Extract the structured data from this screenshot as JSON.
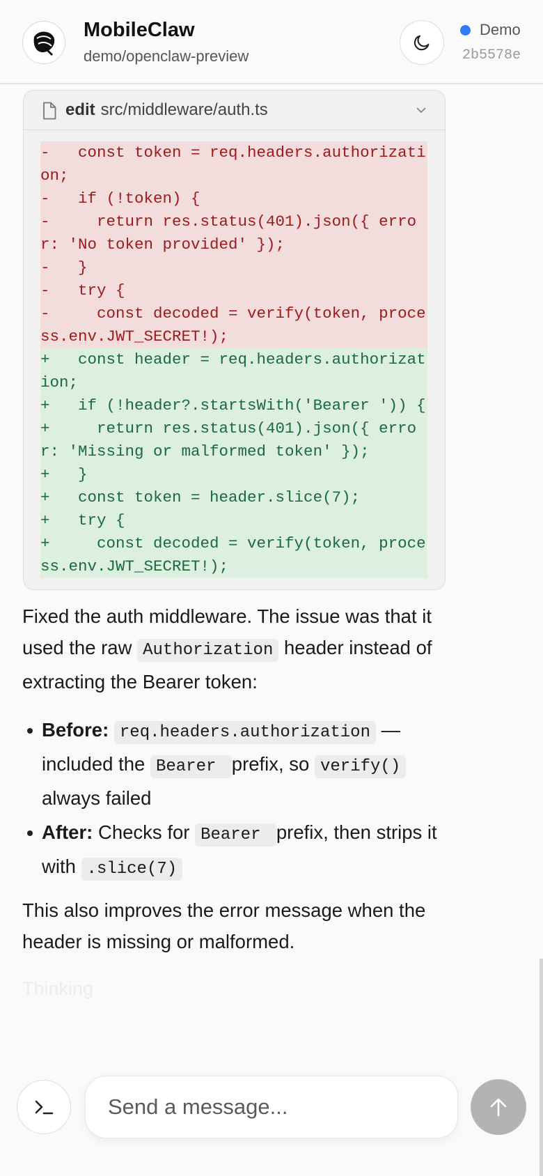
{
  "header": {
    "app_title": "MobileClaw",
    "repo": "demo/openclaw-preview",
    "status_label": "Demo",
    "commit_hash": "2b5578e",
    "status_color": "#2f7cf6",
    "logo_icon": "lobster-claw-icon",
    "theme_icon": "moon-icon"
  },
  "tool_card": {
    "action": "edit",
    "path": "src/middleware/auth.ts",
    "file_icon": "file-icon",
    "toggle_icon": "chevron-down-icon",
    "removed_lines": [
      "-   const token = req.headers.authorization;",
      "-   if (!token) {",
      "-     return res.status(401).json({ error: 'No token provided' });",
      "-   }",
      "-   try {",
      "-     const decoded = verify(token, process.env.JWT_SECRET!);"
    ],
    "added_lines": [
      "+   const header = req.headers.authorization;",
      "+   if (!header?.startsWith('Bearer ')) {",
      "+     return res.status(401).json({ error: 'Missing or malformed token' });",
      "+   }",
      "+   const token = header.slice(7);",
      "+   try {",
      "+     const decoded = verify(token, process.env.JWT_SECRET!);"
    ],
    "removed_color": "#9e1a1a",
    "added_color": "#1b6b3a"
  },
  "message": {
    "intro_1": "Fixed the auth middleware. The issue was that it used the raw ",
    "intro_code": "Authorization",
    "intro_2": " header instead of extracting the Bearer token:",
    "bullets": [
      {
        "label": "Before:",
        "code_1": "req.headers.authorization",
        "text_1": " — included the ",
        "code_2": "Bearer ",
        "text_2": " prefix, so ",
        "code_3": "verify()",
        "text_3": " always failed"
      },
      {
        "label": "After:",
        "text_1": " Checks for ",
        "code_1": "Bearer ",
        "text_2": " prefix, then strips it with ",
        "code_2": ".slice(7)"
      }
    ],
    "outro": "This also improves the error message when the header is missing or malformed.",
    "thinking": "Thinking"
  },
  "composer": {
    "placeholder": "Send a message...",
    "terminal_icon": "terminal-icon",
    "send_icon": "arrow-up-icon"
  }
}
